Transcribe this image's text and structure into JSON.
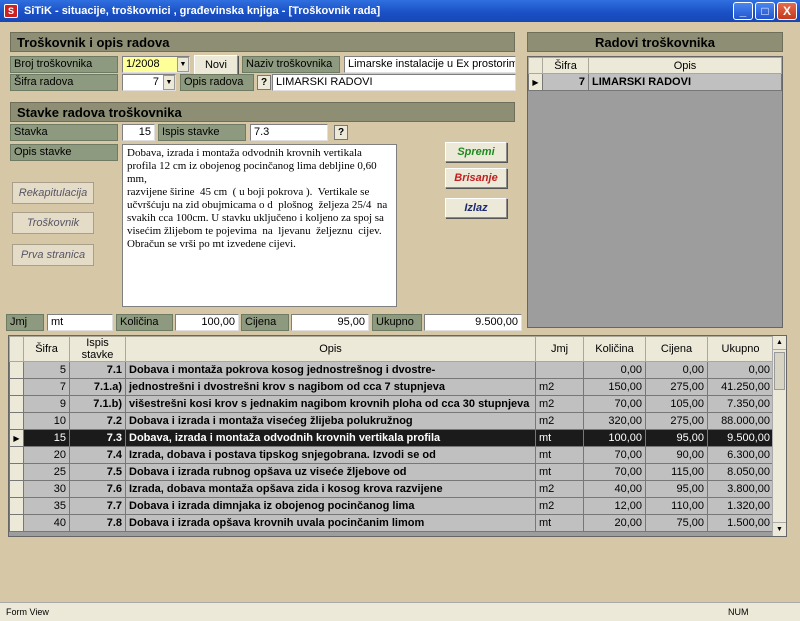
{
  "window": {
    "title": "SiTiK - situacije, troškovnici , građevinska knjiga - [Troškovnik rada]",
    "minimize": "_",
    "maximize": "□",
    "close": "X"
  },
  "header_form": {
    "section_title": "Troškovnik i opis radova",
    "broj_label": "Broj troškovnika",
    "broj_value": "1/2008",
    "novi_button": "Novi",
    "naziv_label": "Naziv troškovnika",
    "naziv_value": "Limarske instalacije u Ex prostorima -",
    "sifra_label": "Šifra radova",
    "sifra_value": "7",
    "opis_label": "Opis radova",
    "help": "?",
    "opis_value": "LIMARSKI RADOVI"
  },
  "stavke": {
    "section_title": "Stavke radova troškovnika",
    "stavka_label": "Stavka",
    "stavka_value": "15",
    "ispis_label": "Ispis stavke",
    "ispis_value": "7.3",
    "help": "?",
    "opis_label": "Opis stavke",
    "opis_text": "Dobava, izrada i montaža odvodnih krovnih vertikala profila 12 cm iz obojenog pocinčanog lima debljine 0,60 mm,\nrazvijene širine  45 cm  ( u boji pokrova ).  Vertikale se učvršćuju na zid obujmicama o d  plošnog  željeza 25/4  na svakih cca 100cm. U stavku uključeno i koljeno za spoj sa visećim žlijebom te pojevima  na  ljevanu  željeznu  cijev. Obračun se vrši po mt izvedene cijevi."
  },
  "actions": {
    "spremi": "Spremi",
    "brisanje": "Brisanje",
    "izlaz": "Izlaz"
  },
  "side_nav": {
    "rekapitulacija": "Rekapitulacija",
    "troskovnik": "Troškovnik",
    "prva_stranica": "Prva stranica"
  },
  "totals": {
    "jmj_label": "Jmj",
    "jmj_value": "mt",
    "kolicina_label": "Količina",
    "kolicina_value": "100,00",
    "cijena_label": "Cijena",
    "cijena_value": "95,00",
    "ukupno_label": "Ukupno",
    "ukupno_value": "9.500,00"
  },
  "radovi": {
    "title": "Radovi troškovnika",
    "columns": [
      "Šifra",
      "Opis"
    ],
    "rows": [
      {
        "sifra": "7",
        "opis": "LIMARSKI RADOVI"
      }
    ]
  },
  "grid": {
    "columns": [
      "Šifra",
      "Ispis stavke",
      "Opis",
      "Jmj",
      "Količina",
      "Cijena",
      "Ukupno"
    ],
    "rows": [
      {
        "sifra": "5",
        "ispis": "7.1",
        "opis": "Dobava i montaža  pokrova kosog jednostrešnog i dvostre-",
        "jmj": "",
        "kolicina": "0,00",
        "cijena": "0,00",
        "ukupno": "0,00"
      },
      {
        "sifra": "7",
        "ispis": "7.1.a)",
        "opis": "jednostrešni i  dvostrešni krov s nagibom od cca 7 stupnjeva",
        "jmj": "m2",
        "kolicina": "150,00",
        "cijena": "275,00",
        "ukupno": "41.250,00"
      },
      {
        "sifra": "9",
        "ispis": "7.1.b)",
        "opis": "višestrešni kosi  krov s jednakim nagibom krovnih ploha  od cca 30 stupnjeva",
        "jmj": "m2",
        "kolicina": "70,00",
        "cijena": "105,00",
        "ukupno": "7.350,00"
      },
      {
        "sifra": "10",
        "ispis": "7.2",
        "opis": "Dobava  i izrada  i  montaža  visećeg  žlijeba  polukružnog",
        "jmj": "m2",
        "kolicina": "320,00",
        "cijena": "275,00",
        "ukupno": "88.000,00"
      },
      {
        "sifra": "15",
        "ispis": "7.3",
        "opis": "Dobava, izrada i montaža odvodnih krovnih vertikala profila",
        "jmj": "mt",
        "kolicina": "100,00",
        "cijena": "95,00",
        "ukupno": "9.500,00"
      },
      {
        "sifra": "20",
        "ispis": "7.4",
        "opis": "Izrada, dobava i postava tipskog snjegobrana. Izvodi se od",
        "jmj": "mt",
        "kolicina": "70,00",
        "cijena": "90,00",
        "ukupno": "6.300,00"
      },
      {
        "sifra": "25",
        "ispis": "7.5",
        "opis": "Dobava  i  izrada  rubnog  opšava  uz  viseće  žljebove od",
        "jmj": "mt",
        "kolicina": "70,00",
        "cijena": "115,00",
        "ukupno": "8.050,00"
      },
      {
        "sifra": "30",
        "ispis": "7.6",
        "opis": "Izrada, dobava montaža opšava zida i kosog krova razvijene",
        "jmj": "m2",
        "kolicina": "40,00",
        "cijena": "95,00",
        "ukupno": "3.800,00"
      },
      {
        "sifra": "35",
        "ispis": "7.7",
        "opis": "Dobava i izrada  dimnjaka iz   obojenog  pocinčanog  lima",
        "jmj": "m2",
        "kolicina": "12,00",
        "cijena": "110,00",
        "ukupno": "1.320,00"
      },
      {
        "sifra": "40",
        "ispis": "7.8",
        "opis": "Dobava  i izrada opšava krovnih uvala pocinčanim limom",
        "jmj": "mt",
        "kolicina": "20,00",
        "cijena": "75,00",
        "ukupno": "1.500,00"
      }
    ],
    "selected_index": 4
  },
  "statusbar": {
    "left": "Form View",
    "right": "NUM"
  },
  "colors": {
    "form_bg": "#d6c7a6",
    "label_bg": "#8d9a7f",
    "header_bg": "#8e8e74",
    "spremi": "#1f8a1f",
    "brisanje": "#c02020",
    "izlaz": "#1c2a6e"
  }
}
